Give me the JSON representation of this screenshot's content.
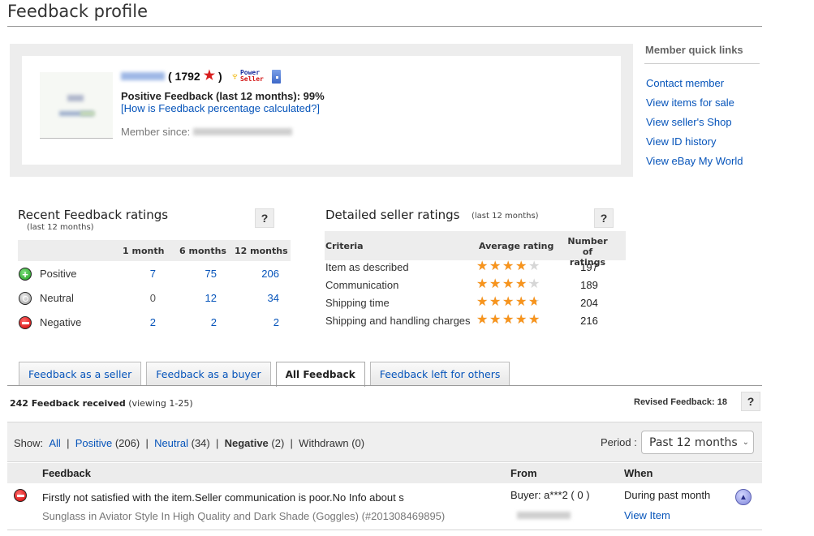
{
  "page": {
    "title": "Feedback profile"
  },
  "profile": {
    "score": "( 1792",
    "score_close": ")",
    "power_seller_line1": "Power",
    "power_seller_line2": "Seller",
    "positive_feedback": "Positive Feedback (last 12 months): 99%",
    "how_calculated_link": "[How is Feedback percentage calculated?]",
    "member_since_label": "Member since:"
  },
  "quick_links": {
    "title": "Member quick links",
    "items": [
      {
        "label": "Contact member"
      },
      {
        "label": "View items for sale"
      },
      {
        "label": "View seller's Shop"
      },
      {
        "label": "View ID history"
      },
      {
        "label": "View eBay My World"
      }
    ]
  },
  "recent_ratings": {
    "title": "Recent Feedback ratings",
    "subtitle": "(last 12 months)",
    "help": "?",
    "columns": [
      "1 month",
      "6 months",
      "12 months"
    ],
    "rows": [
      {
        "type": "positive",
        "label": "Positive",
        "values": [
          "7",
          "75",
          "206"
        ]
      },
      {
        "type": "neutral",
        "label": "Neutral",
        "values": [
          "0",
          "12",
          "34"
        ]
      },
      {
        "type": "negative",
        "label": "Negative",
        "values": [
          "2",
          "2",
          "2"
        ]
      }
    ]
  },
  "detailed_ratings": {
    "title": "Detailed seller ratings",
    "subtitle": "(last 12 months)",
    "help": "?",
    "col_criteria": "Criteria",
    "col_average": "Average rating",
    "col_count_line1": "Number of",
    "col_count_line2": "ratings",
    "rows": [
      {
        "criteria": "Item as described",
        "rating": 4.0,
        "count": "197"
      },
      {
        "criteria": "Communication",
        "rating": 4.1,
        "count": "189"
      },
      {
        "criteria": "Shipping time",
        "rating": 4.6,
        "count": "204"
      },
      {
        "criteria": "Shipping and handling charges",
        "rating": 5.0,
        "count": "216"
      }
    ]
  },
  "tabs": [
    {
      "label": "Feedback as a seller",
      "active": false
    },
    {
      "label": "Feedback as a buyer",
      "active": false
    },
    {
      "label": "All Feedback",
      "active": true
    },
    {
      "label": "Feedback left for others",
      "active": false
    }
  ],
  "summary": {
    "received": "242 Feedback received",
    "viewing": "(viewing 1-25)",
    "revised": "Revised Feedback: 18",
    "help": "?"
  },
  "filter": {
    "show_label": "Show:",
    "all": "All",
    "positive": "Positive",
    "positive_count": "(206)",
    "neutral": "Neutral",
    "neutral_count": "(34)",
    "negative": "Negative",
    "negative_count": "(2)",
    "withdrawn": "Withdrawn (0)",
    "separator": "|",
    "period_label": "Period :",
    "period_value": "Past 12 months"
  },
  "feedback_table": {
    "col_feedback": "Feedback",
    "col_from": "From",
    "col_when": "When",
    "rows": [
      {
        "type": "negative",
        "comment": "Firstly not satisfied with the item.Seller communication is poor.No Info about s",
        "item": "Sunglass in Aviator Style In High Quality and Dark Shade (Goggles) (#201308469895)",
        "from": "Buyer: a***2 ( 0 )",
        "when": "During past month",
        "view_item": "View Item"
      }
    ]
  }
}
